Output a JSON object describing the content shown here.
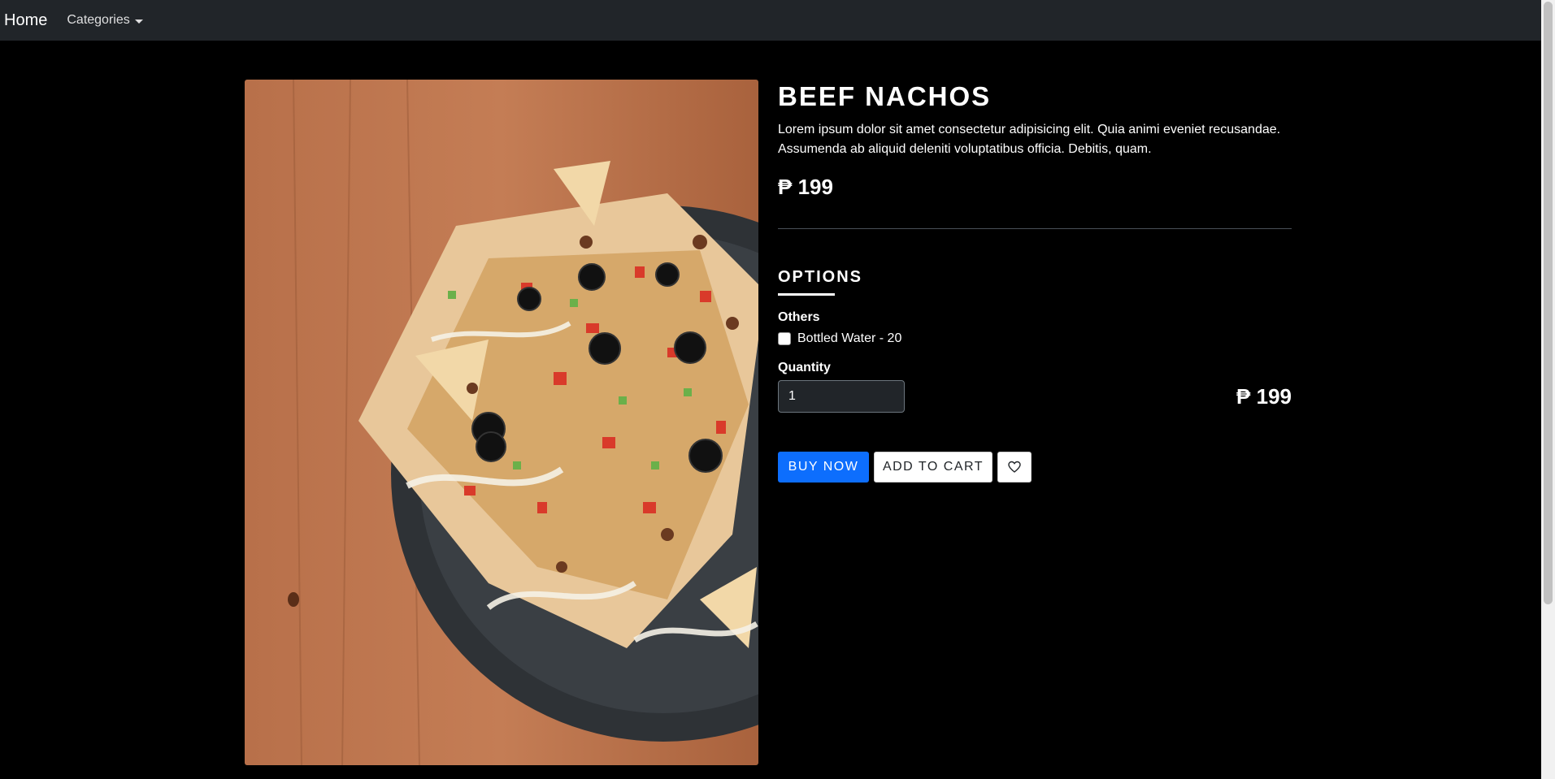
{
  "navbar": {
    "brand": "Home",
    "categories_label": "Categories"
  },
  "product": {
    "title": "BEEF NACHOS",
    "description": "Lorem ipsum dolor sit amet consectetur adipisicing elit. Quia animi eveniet recusandae. Assumenda ab aliquid deleniti voluptatibus officia. Debitis, quam.",
    "price": "₱ 199"
  },
  "options": {
    "heading": "OPTIONS",
    "group_label": "Others",
    "items": [
      {
        "label": "Bottled Water - 20",
        "checked": false
      }
    ]
  },
  "quantity": {
    "label": "Quantity",
    "value": "1"
  },
  "total": "₱ 199",
  "actions": {
    "buy_now": "BUY NOW",
    "add_to_cart": "ADD TO CART",
    "wishlist_icon": "heart-icon"
  },
  "colors": {
    "navbar_bg": "#212529",
    "page_bg": "#000000",
    "primary": "#0d6efd"
  }
}
